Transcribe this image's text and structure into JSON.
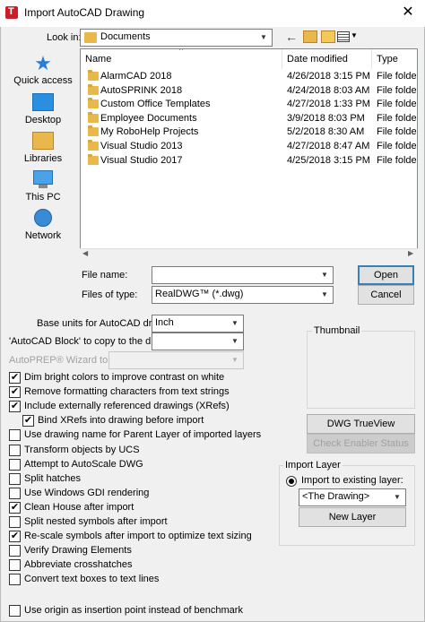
{
  "window": {
    "title": "Import AutoCAD Drawing",
    "close_glyph": "✕"
  },
  "lookin": {
    "label": "Look in:",
    "value": "Documents"
  },
  "places": [
    {
      "label": "Quick access",
      "icon": "star-icon"
    },
    {
      "label": "Desktop",
      "icon": "desktop-icon"
    },
    {
      "label": "Libraries",
      "icon": "libraries-icon"
    },
    {
      "label": "This PC",
      "icon": "computer-icon"
    },
    {
      "label": "Network",
      "icon": "network-icon"
    }
  ],
  "files": {
    "columns": [
      "Name",
      "Date modified",
      "Type"
    ],
    "rows": [
      {
        "name": "AlarmCAD 2018",
        "date": "4/26/2018 3:15 PM",
        "type": "File folder"
      },
      {
        "name": "AutoSPRINK 2018",
        "date": "4/24/2018 8:03 AM",
        "type": "File folder"
      },
      {
        "name": "Custom Office Templates",
        "date": "4/27/2018 1:33 PM",
        "type": "File folder"
      },
      {
        "name": "Employee Documents",
        "date": "3/9/2018 8:03 PM",
        "type": "File folder"
      },
      {
        "name": "My RoboHelp Projects",
        "date": "5/2/2018 8:30 AM",
        "type": "File folder"
      },
      {
        "name": "Visual Studio 2013",
        "date": "4/27/2018 8:47 AM",
        "type": "File folder"
      },
      {
        "name": "Visual Studio 2017",
        "date": "4/25/2018 3:15 PM",
        "type": "File folder"
      }
    ]
  },
  "filename": {
    "label": "File name:",
    "value": ""
  },
  "filetype": {
    "label": "Files of type:",
    "value": "RealDWG™ (*.dwg)"
  },
  "buttons": {
    "open": "Open",
    "cancel": "Cancel",
    "dwg_trueview": "DWG TrueView",
    "check_enabler": "Check Enabler Status",
    "new_layer": "New Layer"
  },
  "base_units": {
    "label": "Base units for AutoCAD drawing",
    "value": "Inch"
  },
  "acad_block": {
    "label": "'AutoCAD Block' to copy to the drawing",
    "value": ""
  },
  "autoprep": {
    "label": "AutoPREP® Wizard to Run",
    "value": ""
  },
  "thumbnail": {
    "label": "Thumbnail"
  },
  "import_layer": {
    "label": "Import Layer",
    "radio_label": "Import to existing layer:",
    "radio_checked": true,
    "value": "<The Drawing>"
  },
  "options": [
    {
      "label": "Dim bright colors to improve contrast on white",
      "checked": true
    },
    {
      "label": "Remove formatting characters from text strings",
      "checked": true
    },
    {
      "label": "Include externally referenced drawings (XRefs)",
      "checked": true
    },
    {
      "label": "Bind XRefs into drawing before import",
      "checked": true,
      "indent": true
    },
    {
      "label": "Use drawing name for Parent Layer of imported layers",
      "checked": false
    },
    {
      "label": "Transform objects by UCS",
      "checked": false
    },
    {
      "label": "Attempt to AutoScale DWG",
      "checked": false
    },
    {
      "label": "Split hatches",
      "checked": false
    },
    {
      "label": "Use Windows GDI rendering",
      "checked": false
    },
    {
      "label": "Clean House after import",
      "checked": true
    },
    {
      "label": "Split nested symbols after import",
      "checked": false
    },
    {
      "label": "Re-scale symbols after import to optimize text sizing",
      "checked": true
    },
    {
      "label": "Verify Drawing Elements",
      "checked": false
    },
    {
      "label": "Abbreviate crosshatches",
      "checked": false
    },
    {
      "label": "Convert text boxes to text lines",
      "checked": false
    }
  ],
  "use_origin": {
    "label": "Use origin as insertion point instead of benchmark",
    "checked": false
  },
  "colors": {
    "title_icon": "#c8202a",
    "folder": "#e8b94a",
    "default_border": "#3c7fb1"
  }
}
